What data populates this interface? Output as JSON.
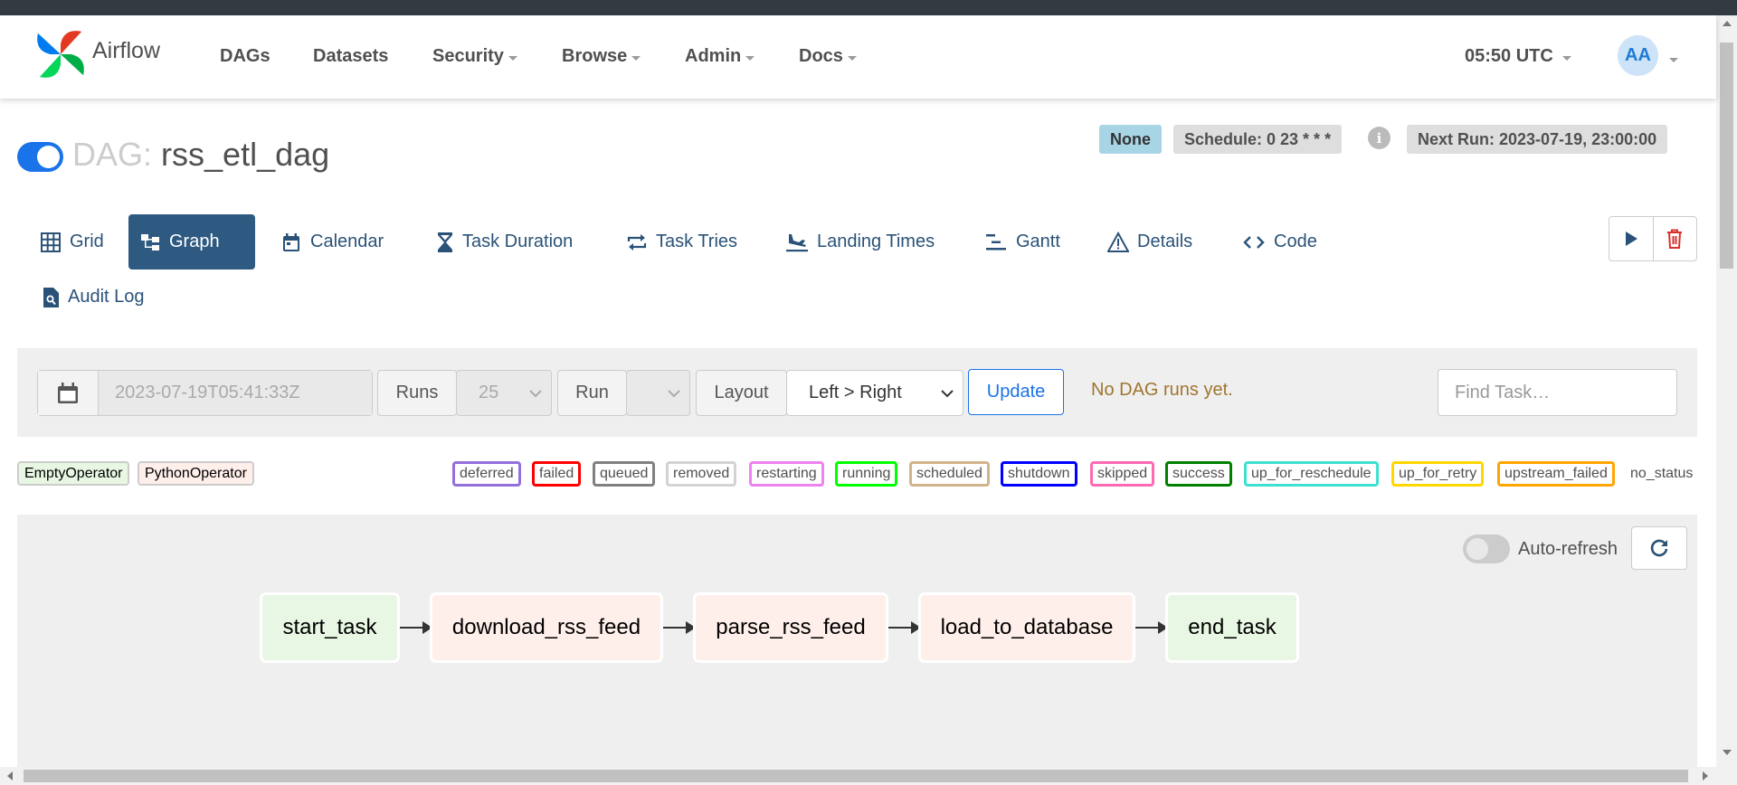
{
  "app": {
    "brand": "Airflow"
  },
  "nav": {
    "items": [
      {
        "label": "DAGs",
        "dropdown": false
      },
      {
        "label": "Datasets",
        "dropdown": false
      },
      {
        "label": "Security",
        "dropdown": true
      },
      {
        "label": "Browse",
        "dropdown": true
      },
      {
        "label": "Admin",
        "dropdown": true
      },
      {
        "label": "Docs",
        "dropdown": true
      }
    ],
    "time": "05:50 UTC",
    "avatar": "AA"
  },
  "dag": {
    "prefix": "DAG:",
    "name": "rss_etl_dag",
    "paused": false,
    "dataset_badge": "None",
    "schedule": "Schedule: 0 23 * * *",
    "next_run": "Next Run: 2023-07-19, 23:00:00"
  },
  "tabs": [
    {
      "label": "Grid",
      "icon": "grid-icon",
      "active": false
    },
    {
      "label": "Graph",
      "icon": "graph-icon",
      "active": true
    },
    {
      "label": "Calendar",
      "icon": "calendar-icon",
      "active": false
    },
    {
      "label": "Task Duration",
      "icon": "hourglass-icon",
      "active": false
    },
    {
      "label": "Task Tries",
      "icon": "retry-icon",
      "active": false
    },
    {
      "label": "Landing Times",
      "icon": "plane-landing-icon",
      "active": false
    },
    {
      "label": "Gantt",
      "icon": "gantt-icon",
      "active": false
    },
    {
      "label": "Details",
      "icon": "warning-triangle-icon",
      "active": false
    },
    {
      "label": "Code",
      "icon": "code-icon",
      "active": false
    },
    {
      "label": "Audit Log",
      "icon": "audit-log-icon",
      "active": false
    }
  ],
  "controls": {
    "date_value": "2023-07-19T05:41:33Z",
    "runs_label": "Runs",
    "runs_value": "25",
    "run_label": "Run",
    "run_value": "",
    "layout_label": "Layout",
    "layout_value": "Left > Right",
    "update_label": "Update",
    "no_runs_message": "No DAG runs yet.",
    "find_task_placeholder": "Find Task…"
  },
  "legend": {
    "operators": [
      {
        "label": "EmptyOperator",
        "color": "#e8f7e4"
      },
      {
        "label": "PythonOperator",
        "color": "#ffefeb"
      }
    ],
    "states": [
      {
        "label": "deferred",
        "color": "#9370db"
      },
      {
        "label": "failed",
        "color": "#ff0000"
      },
      {
        "label": "queued",
        "color": "#808080"
      },
      {
        "label": "removed",
        "color": "#d3d3d3"
      },
      {
        "label": "restarting",
        "color": "#ee82ee"
      },
      {
        "label": "running",
        "color": "#00ff00"
      },
      {
        "label": "scheduled",
        "color": "#d2b48c"
      },
      {
        "label": "shutdown",
        "color": "#0000ff"
      },
      {
        "label": "skipped",
        "color": "#ff69b4"
      },
      {
        "label": "success",
        "color": "#008000"
      },
      {
        "label": "up_for_reschedule",
        "color": "#40e0d0"
      },
      {
        "label": "up_for_retry",
        "color": "#ffd700"
      },
      {
        "label": "upstream_failed",
        "color": "#ffa500"
      },
      {
        "label": "no_status",
        "color": ""
      }
    ]
  },
  "graph": {
    "auto_refresh_label": "Auto-refresh",
    "auto_refresh_on": false,
    "tasks": [
      {
        "id": "start_task",
        "operator": "EmptyOperator"
      },
      {
        "id": "download_rss_feed",
        "operator": "PythonOperator"
      },
      {
        "id": "parse_rss_feed",
        "operator": "PythonOperator"
      },
      {
        "id": "load_to_database",
        "operator": "PythonOperator"
      },
      {
        "id": "end_task",
        "operator": "EmptyOperator"
      }
    ]
  },
  "colors": {
    "accent": "#1a73e8",
    "active_tab": "#2e5a82",
    "link": "#2a5278"
  }
}
